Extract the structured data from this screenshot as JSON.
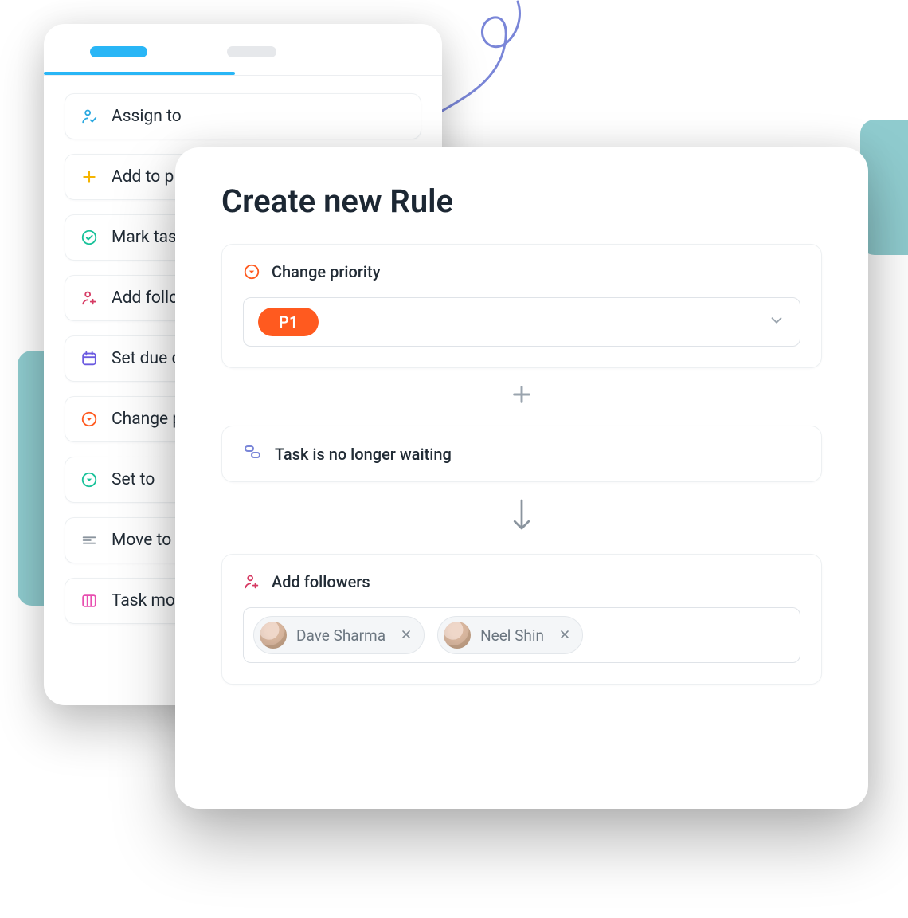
{
  "actions": [
    {
      "label": "Assign to"
    },
    {
      "label": "Add to p"
    },
    {
      "label": "Mark tas"
    },
    {
      "label": "Add follo"
    },
    {
      "label": "Set due d"
    },
    {
      "label": "Change p"
    },
    {
      "label": "Set to"
    },
    {
      "label": "Move to"
    },
    {
      "label": "Task mov"
    }
  ],
  "rule": {
    "title": "Create new Rule",
    "priority_label": "Change priority",
    "priority_value": "P1",
    "condition_label": "Task is no longer waiting",
    "followers_label": "Add followers",
    "followers": [
      {
        "name": "Dave Sharma"
      },
      {
        "name": "Neel Shin"
      }
    ]
  }
}
